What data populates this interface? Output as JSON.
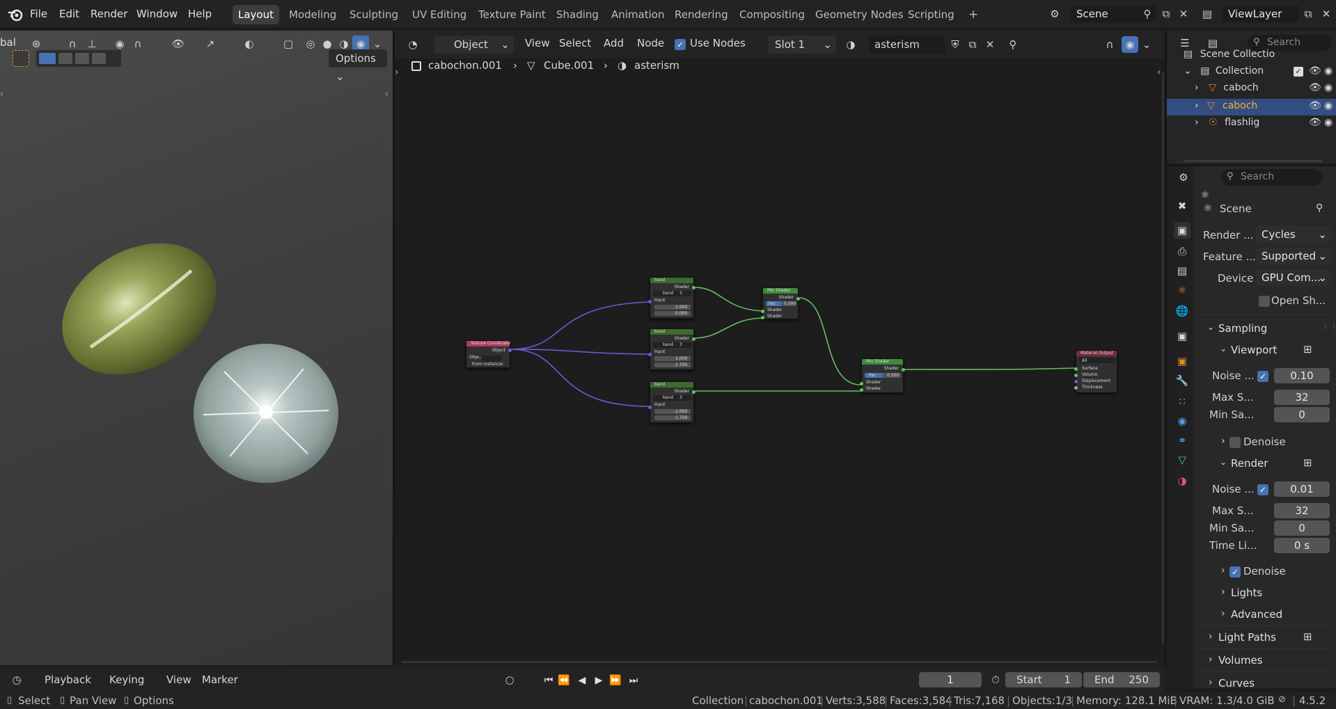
{
  "topbar": {
    "menus": [
      "File",
      "Edit",
      "Render",
      "Window",
      "Help"
    ],
    "workspaces": [
      "Layout",
      "Modeling",
      "Sculpting",
      "UV Editing",
      "Texture Paint",
      "Shading",
      "Animation",
      "Rendering",
      "Compositing",
      "Geometry Nodes",
      "Scripting"
    ],
    "add_tab": "+",
    "scene_label": "Scene",
    "viewlayer_label": "ViewLayer"
  },
  "viewport": {
    "transform_label": "bal",
    "options_label": "Options"
  },
  "node_editor": {
    "mode": "Object",
    "menus": [
      "View",
      "Select",
      "Add",
      "Node"
    ],
    "use_nodes_label": "Use Nodes",
    "slot": "Slot 1",
    "material": "asterism",
    "breadcrumb": [
      "cabochon.001",
      "Cube.001",
      "asterism"
    ],
    "nodes": {
      "texcoord": {
        "title": "Texture Coordinate",
        "out": "Object",
        "obj": "Obje...",
        "from_instancer": "From Instancer"
      },
      "band1": {
        "title": "band",
        "out": "Shader",
        "grp": "band",
        "num": "3",
        "in": "Input",
        "x": "1.000",
        "y": "0.000"
      },
      "band2": {
        "title": "band",
        "out": "Shader",
        "grp": "band",
        "num": "3",
        "in": "Input",
        "x": "1.000",
        "y": "1.750"
      },
      "band3": {
        "title": "band",
        "out": "Shader",
        "grp": "band",
        "num": "3",
        "in": "Input",
        "x": "-1.000",
        "y": "1.750"
      },
      "mix1": {
        "title": "Mix Shader",
        "out": "Shader",
        "fac": "Fac",
        "facval": "0.500",
        "s1": "Shader",
        "s2": "Shader"
      },
      "mix2": {
        "title": "Mix Shader",
        "out": "Shader",
        "fac": "Fac",
        "facval": "0.500",
        "s1": "Shader",
        "s2": "Shader"
      },
      "output": {
        "title": "Material Output",
        "target": "All",
        "surface": "Surface",
        "volume": "Volume",
        "disp": "Displacement",
        "thick": "Thickness"
      }
    }
  },
  "outliner": {
    "search_placeholder": "Search",
    "root": "Scene Collectio",
    "collection": "Collection",
    "items": [
      "caboch",
      "caboch",
      "flashlig"
    ]
  },
  "properties": {
    "search_placeholder": "Search",
    "scene": "Scene",
    "render_engine_label": "Render ...",
    "render_engine": "Cycles",
    "feature_label": "Feature ...",
    "feature": "Supported",
    "device_label": "Device",
    "device": "GPU Com...",
    "open_shading": "Open Sh...",
    "sampling": "Sampling",
    "viewport": "Viewport",
    "vp_noise_label": "Noise ...",
    "vp_noise": "0.10",
    "vp_max_label": "Max S...",
    "vp_max": "32",
    "vp_min_label": "Min Sa...",
    "vp_min": "0",
    "vp_denoise": "Denoise",
    "render": "Render",
    "r_noise_label": "Noise ...",
    "r_noise": "0.01",
    "r_max_label": "Max S...",
    "r_max": "32",
    "r_min_label": "Min Sa...",
    "r_min": "0",
    "r_time_label": "Time Li...",
    "r_time": "0 s",
    "r_denoise": "Denoise",
    "lights": "Lights",
    "advanced": "Advanced",
    "light_paths": "Light Paths",
    "volumes": "Volumes",
    "curves": "Curves"
  },
  "timeline": {
    "menus": [
      "Playback",
      "Keying",
      "View",
      "Marker"
    ],
    "frame": "1",
    "start_label": "Start",
    "start": "1",
    "end_label": "End",
    "end": "250"
  },
  "status": {
    "select": "Select",
    "pan": "Pan View",
    "options": "Options",
    "collection": "Collection",
    "object": "cabochon.001",
    "verts": "Verts:3,588",
    "faces": "Faces:3,584",
    "tris": "Tris:7,168",
    "objects": "Objects:1/3",
    "memory": "Memory: 128.1 MiB",
    "vram": "VRAM: 1.3/4.0 GiB",
    "version": "4.5.2"
  },
  "colors": {
    "accent": "#4772b3",
    "active_tab": "#3d3d3d",
    "node_green": "#4a9a4a",
    "node_red": "#c2345a"
  }
}
